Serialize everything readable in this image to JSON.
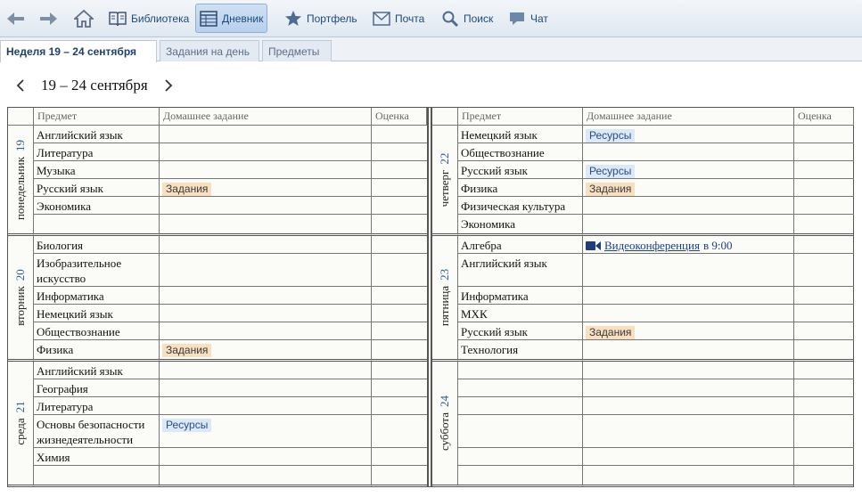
{
  "toolbar": {
    "back_label": "",
    "forward_label": "",
    "items": [
      {
        "label": "Библиотека"
      },
      {
        "label": "Дневник"
      },
      {
        "label": "Портфель"
      },
      {
        "label": "Почта"
      },
      {
        "label": "Поиск"
      },
      {
        "label": "Чат"
      }
    ]
  },
  "tabs": [
    {
      "label": "Неделя 19 – 24 сентября"
    },
    {
      "label": "Задания на день"
    },
    {
      "label": "Предметы"
    }
  ],
  "week": {
    "title": "19 – 24 сентября"
  },
  "columns": {
    "subject": "Предмет",
    "homework": "Домашнее задание",
    "grade": "Оценка"
  },
  "days": [
    {
      "name": "понедельник",
      "num": "19",
      "lessons": [
        {
          "subject": "Английский язык"
        },
        {
          "subject": "Литература"
        },
        {
          "subject": "Музыка"
        },
        {
          "subject": "Русский язык",
          "chip": "Задания",
          "chip_type": "tasks"
        },
        {
          "subject": "Экономика"
        },
        {
          "subject": ""
        }
      ]
    },
    {
      "name": "вторник",
      "num": "20",
      "lessons": [
        {
          "subject": "Биология"
        },
        {
          "subject": "Изобразительное искусство",
          "tall": true
        },
        {
          "subject": "Информатика"
        },
        {
          "subject": "Немецкий язык"
        },
        {
          "subject": "Обществознание"
        },
        {
          "subject": "Физика",
          "chip": "Задания",
          "chip_type": "tasks"
        }
      ]
    },
    {
      "name": "среда",
      "num": "21",
      "lessons": [
        {
          "subject": "Английский язык"
        },
        {
          "subject": "География"
        },
        {
          "subject": "Литература"
        },
        {
          "subject": "Основы безопасности жизнедеятельности",
          "tall": true,
          "chip": "Ресурсы",
          "chip_type": "res"
        },
        {
          "subject": "Химия"
        },
        {
          "subject": ""
        }
      ]
    },
    {
      "name": "четверг",
      "num": "22",
      "lessons": [
        {
          "subject": "Немецкий язык",
          "chip": "Ресурсы",
          "chip_type": "res"
        },
        {
          "subject": "Обществознание"
        },
        {
          "subject": "Русский язык",
          "chip": "Ресурсы",
          "chip_type": "res"
        },
        {
          "subject": "Физика",
          "chip": "Задания",
          "chip_type": "tasks"
        },
        {
          "subject": "Физическая культура"
        },
        {
          "subject": "Экономика"
        }
      ]
    },
    {
      "name": "пятница",
      "num": "23",
      "lessons": [
        {
          "subject": "Алгебра",
          "video": {
            "link": "Видеоконференция",
            "time": "в 9:00"
          }
        },
        {
          "subject": "Английский язык",
          "tall": true
        },
        {
          "subject": "Информатика"
        },
        {
          "subject": "МХК"
        },
        {
          "subject": "Русский язык",
          "chip": "Задания",
          "chip_type": "tasks"
        },
        {
          "subject": "Технология"
        }
      ]
    },
    {
      "name": "суббота",
      "num": "24",
      "lessons": [
        {
          "subject": ""
        },
        {
          "subject": ""
        },
        {
          "subject": ""
        },
        {
          "subject": "",
          "tall": true
        },
        {
          "subject": ""
        },
        {
          "subject": ""
        }
      ]
    }
  ],
  "colors": {
    "accent": "#2e5a99",
    "tasks_chip": "#f7dfc0",
    "resources_chip": "#dae8f7"
  }
}
